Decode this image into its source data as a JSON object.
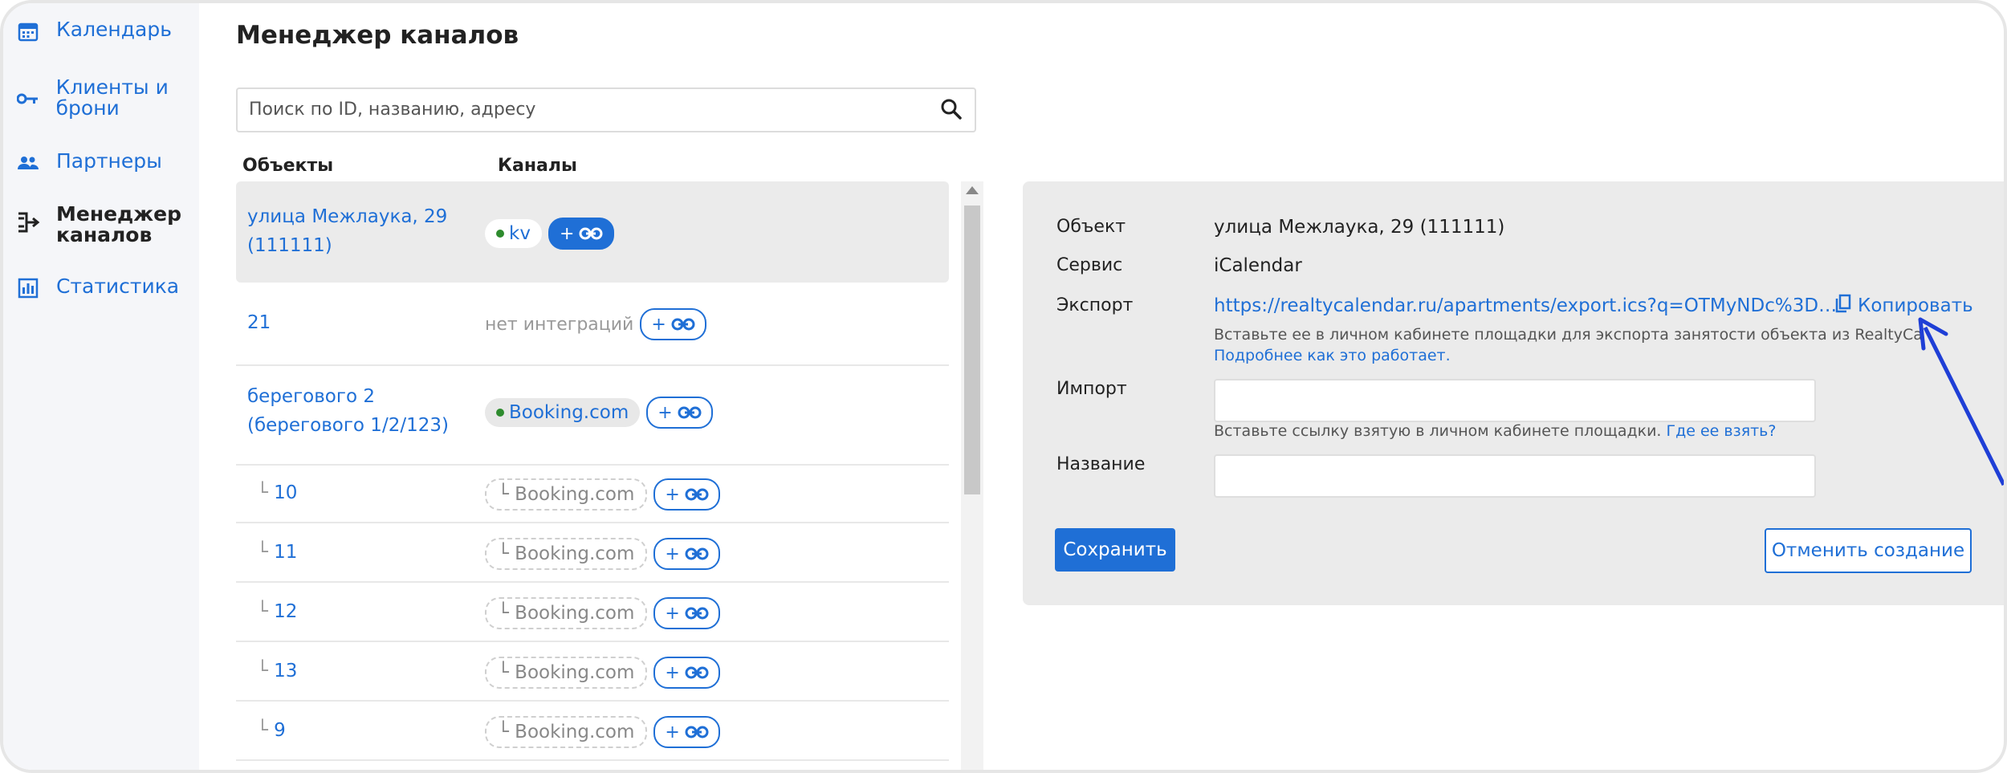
{
  "sidebar": {
    "items": [
      {
        "label": "Календарь",
        "icon": "calendar-icon"
      },
      {
        "label": "Клиенты и брони",
        "icon": "key-icon"
      },
      {
        "label": "Партнеры",
        "icon": "people-icon"
      },
      {
        "label": "Менеджер каналов",
        "icon": "channel-manager-icon"
      },
      {
        "label": "Статистика",
        "icon": "chart-icon"
      }
    ]
  },
  "page": {
    "title": "Менеджер каналов",
    "search_placeholder": "Поиск по ID, названию, адресу"
  },
  "table": {
    "col_objects": "Объекты",
    "col_channels": "Каналы",
    "rows": [
      {
        "object": "улица Межлаука, 29 (111111)",
        "channel": "kv"
      },
      {
        "object": "21",
        "channel": "нет интеграций"
      },
      {
        "object": "берегового 2 (берегового 1/2/123)",
        "channel": "Booking.com"
      },
      {
        "object": "10",
        "channel": "Booking.com"
      },
      {
        "object": "11",
        "channel": "Booking.com"
      },
      {
        "object": "12",
        "channel": "Booking.com"
      },
      {
        "object": "13",
        "channel": "Booking.com"
      },
      {
        "object": "9",
        "channel": "Booking.com"
      }
    ],
    "add_label": "+",
    "child_prefix": "└"
  },
  "details": {
    "object_label": "Объект",
    "object_value": "улица Межлаука, 29 (111111)",
    "service_label": "Сервис",
    "service_value": "iCalendar",
    "export_label": "Экспорт",
    "export_url": "https://realtycalendar.ru/apartments/export.ics?q=OTMyNDc%3D…",
    "copy_label": "Копировать",
    "export_hint": "Вставьте ее в личном кабинете площадки для экспорта занятости объекта из RealtyCa",
    "export_more": "Подробнее как это работает.",
    "import_label": "Импорт",
    "import_value": "",
    "import_hint": "Вставьте ссылку взятую в личном кабинете площадки.",
    "import_where": "Где ее взять?",
    "name_label": "Название",
    "name_value": "",
    "save_button": "Сохранить",
    "cancel_button": "Отменить создание"
  },
  "colors": {
    "accent": "#1f6fd6",
    "status_green": "#2e8b2e",
    "annotation_arrow": "#1f3fd6"
  }
}
